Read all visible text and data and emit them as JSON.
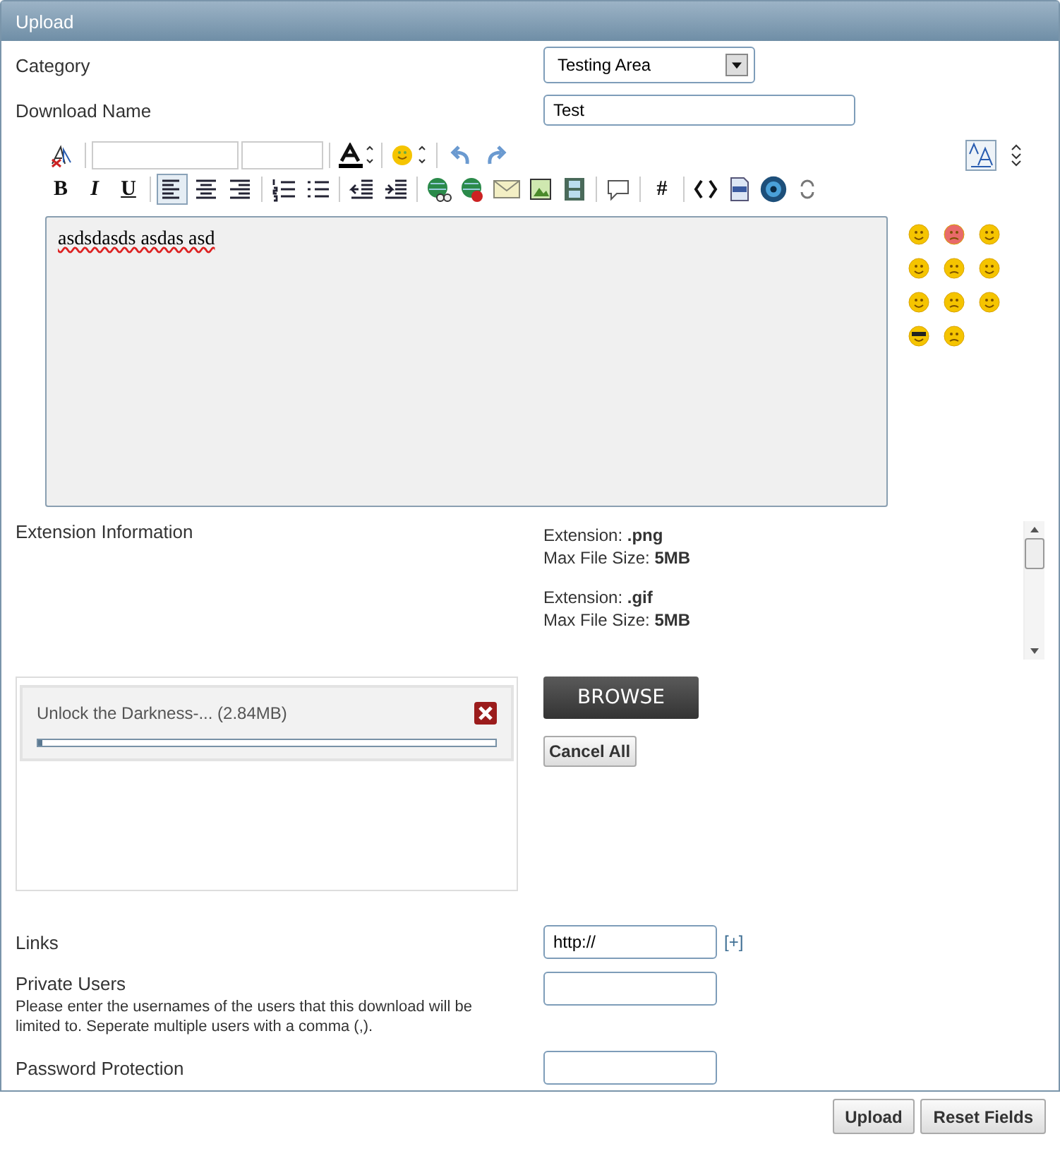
{
  "panel": {
    "title": "Upload"
  },
  "category": {
    "label": "Category",
    "value": "Testing Area"
  },
  "download_name": {
    "label": "Download Name",
    "value": "Test"
  },
  "toolbar": {
    "row_1": [
      {
        "kind": "icon"
      },
      {
        "kind": "select"
      },
      {
        "kind": "select"
      },
      {
        "kind": "icon"
      },
      {
        "kind": "icon"
      },
      {
        "kind": "icon"
      },
      {
        "kind": "icon"
      }
    ],
    "row_2": [
      {
        "kind": "text",
        "label": "B",
        "selected": false
      },
      {
        "kind": "text",
        "label": "I",
        "selected": false
      },
      {
        "kind": "text",
        "label": "U",
        "selected": false
      },
      {
        "kind": "icon",
        "selected": true
      },
      {
        "kind": "icon",
        "selected": false
      },
      {
        "kind": "icon",
        "selected": false
      },
      {
        "kind": "icon",
        "selected": false
      },
      {
        "kind": "icon",
        "selected": false
      },
      {
        "kind": "icon",
        "selected": false
      },
      {
        "kind": "icon",
        "selected": false
      },
      {
        "kind": "icon",
        "selected": false
      },
      {
        "kind": "icon",
        "selected": false
      },
      {
        "kind": "icon",
        "selected": false
      },
      {
        "kind": "icon",
        "selected": false
      },
      {
        "kind": "icon",
        "selected": false
      },
      {
        "kind": "icon",
        "selected": false
      },
      {
        "kind": "text",
        "label": "#",
        "selected": false
      },
      {
        "kind": "icon",
        "selected": false
      },
      {
        "kind": "icon",
        "selected": false
      },
      {
        "kind": "icon",
        "selected": false
      },
      {
        "kind": "icon",
        "selected": false
      }
    ]
  },
  "editor": {
    "value": "asdsdasds asdas asd"
  },
  "extension_info": {
    "label": "Extension Information",
    "items": [
      {
        "extension": "Extension: **.png**",
        "max_size": "Max File Size: **5MB**"
      },
      {
        "extension": "Extension: **.gif**",
        "max_size": "Max File Size: **5MB**"
      }
    ]
  },
  "upload_queue": [
    {
      "file": "Unlock the Darkness-... (2.84MB)",
      "level": 0.01
    }
  ],
  "browse_button": "BROWSE",
  "cancel_all_button": "Cancel All",
  "links": {
    "label": "Links",
    "value": "http://",
    "add_link": "[+]"
  },
  "private_users": {
    "label": "Private Users",
    "help": "Please enter the usernames of the users that this download will be limited to. Seperate multiple users with a comma (,)."
  },
  "password_protection": {
    "label": "Password Protection"
  },
  "buttons": [
    "Upload",
    "Reset Fields"
  ]
}
